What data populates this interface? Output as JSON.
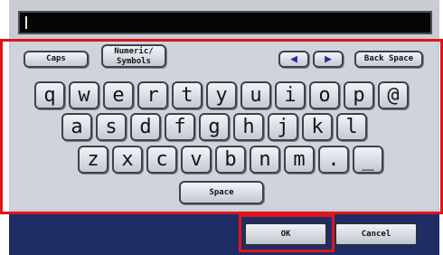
{
  "input": {
    "value": ""
  },
  "keys": {
    "caps": "Caps",
    "numeric_line1": "Numeric/",
    "numeric_line2": "Symbols",
    "left_arrow": "◀",
    "right_arrow": "▶",
    "backspace": "Back Space",
    "row1": [
      "q",
      "w",
      "e",
      "r",
      "t",
      "y",
      "u",
      "i",
      "o",
      "p",
      "@"
    ],
    "row2": [
      "a",
      "s",
      "d",
      "f",
      "g",
      "h",
      "j",
      "k",
      "l"
    ],
    "row3": [
      "z",
      "x",
      "c",
      "v",
      "b",
      "n",
      "m",
      ".",
      "_"
    ],
    "space": "Space"
  },
  "buttons": {
    "ok": "OK",
    "cancel": "Cancel"
  },
  "colors": {
    "highlight": "#e0151b",
    "bar": "#1f2d66",
    "panel": "#cfd3db"
  }
}
